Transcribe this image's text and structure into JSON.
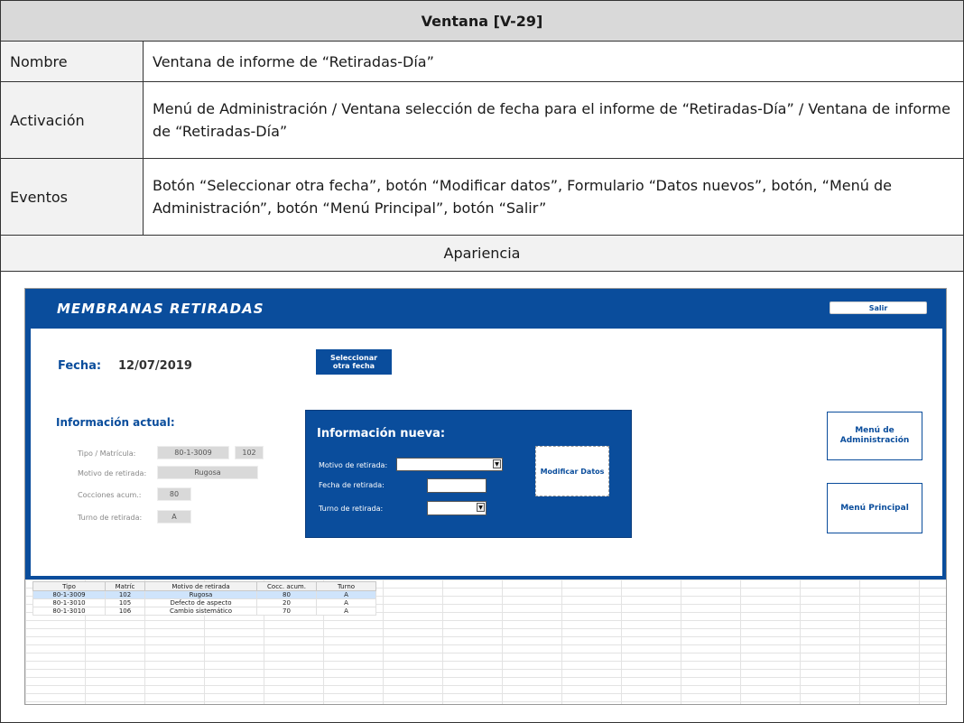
{
  "doc": {
    "title": "Ventana [V-29]",
    "nombre_label": "Nombre",
    "nombre_value": "Ventana de informe de “Retiradas-Día”",
    "activacion_label": "Activación",
    "activacion_value": "Menú de Administración / Ventana selección de fecha para el informe de “Retiradas-Día” / Ventana de informe de “Retiradas-Día”",
    "eventos_label": "Eventos",
    "eventos_value": "Botón “Seleccionar otra fecha”, botón “Modificar datos”, Formulario “Datos nuevos”, botón, “Menú de Administración”, botón “Menú Principal”, botón “Salir”",
    "apariencia_label": "Apariencia"
  },
  "app": {
    "banner_title": "MEMBRANAS RETIRADAS",
    "salir": "Salir",
    "fecha_label": "Fecha:",
    "fecha_value": "12/07/2019",
    "sel_fecha": "Seleccionar otra fecha",
    "info_actual": {
      "title": "Información actual:",
      "tipo_label": "Tipo / Matrícula:",
      "tipo_value": "80-1-3009",
      "matricula_value": "102",
      "motivo_label": "Motivo de retirada:",
      "motivo_value": "Rugosa",
      "cocciones_label": "Cocciones acum.:",
      "cocciones_value": "80",
      "turno_label": "Turno de retirada:",
      "turno_value": "A"
    },
    "info_nueva": {
      "title": "Información nueva:",
      "motivo_label": "Motivo de retirada:",
      "fecha_label": "Fecha de retirada:",
      "turno_label": "Turno de retirada:",
      "modificar": "Modificar Datos"
    },
    "menu_admin": "Menú de Administración",
    "menu_principal": "Menú Principal",
    "table": {
      "headers": [
        "Tipo",
        "Matríc",
        "Motivo de retirada",
        "Cocc. acum.",
        "Turno"
      ],
      "rows": [
        [
          "80-1-3009",
          "102",
          "Rugosa",
          "80",
          "A"
        ],
        [
          "80-1-3010",
          "105",
          "Defecto de aspecto",
          "20",
          "A"
        ],
        [
          "80-1-3010",
          "106",
          "Cambio sistemático",
          "70",
          "A"
        ]
      ]
    }
  }
}
